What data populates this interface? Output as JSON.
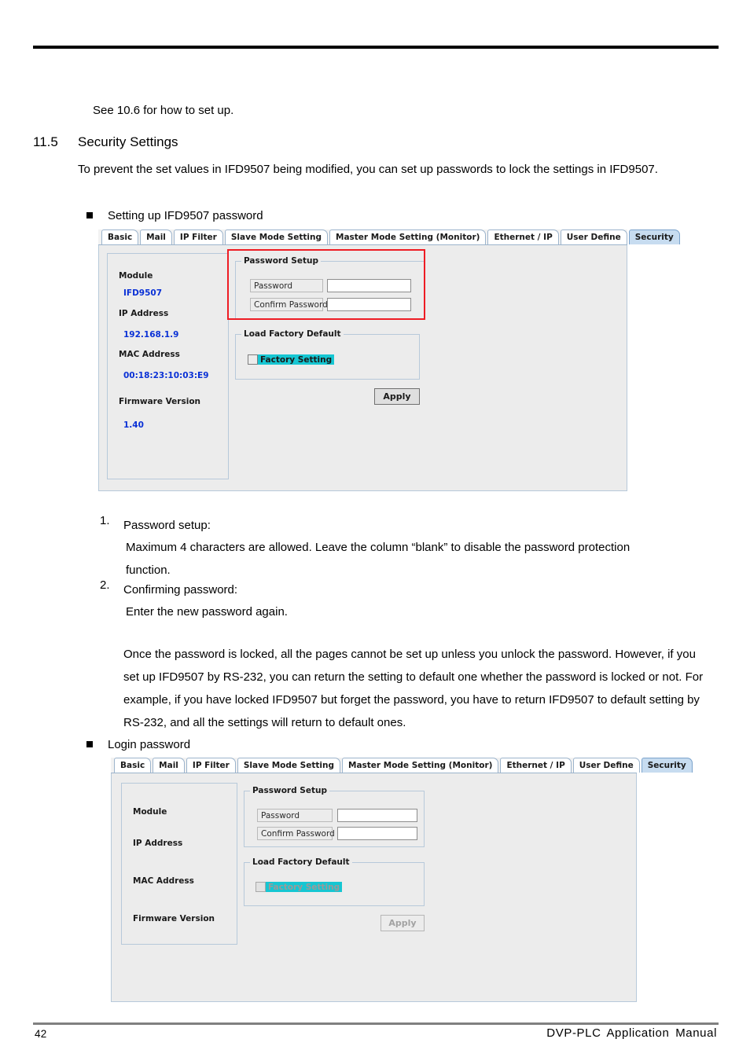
{
  "document": {
    "footer": {
      "page_number": "42",
      "manual_title": "DVP-PLC  Application  Manual"
    }
  },
  "content": {
    "intro_line": "See 10.6 for how to set up.",
    "section": {
      "number": "11.5",
      "title": "Security Settings",
      "paragraph": "To prevent the set values in IFD9507 being modified, you can set up passwords to lock the settings in IFD9507."
    },
    "bullet_1": "Setting up IFD9507 password",
    "bullet_2": "Login password",
    "list": [
      {
        "num": "1.",
        "title": "Password setup:",
        "body": "Maximum 4 characters are allowed. Leave the column “blank” to disable the password protection function."
      },
      {
        "num": "2.",
        "title": "Confirming password:",
        "body": "Enter the new password again."
      }
    ],
    "note_paragraph": "Once the password is locked, all the pages cannot be set up unless you unlock the password. However, if you set up IFD9507 by RS-232, you can return the setting to default one whether the password is locked or not. For example, if you have locked IFD9507 but forget the password, you have to return IFD9507 to default setting by RS-232, and all the settings will return to default ones."
  },
  "screenshot_1": {
    "tabs": [
      {
        "label": "Basic",
        "active": false
      },
      {
        "label": "Mail",
        "active": false
      },
      {
        "label": "IP Filter",
        "active": false
      },
      {
        "label": "Slave Mode Setting",
        "active": false
      },
      {
        "label": "Master Mode Setting (Monitor)",
        "active": false
      },
      {
        "label": "Ethernet / IP",
        "active": false
      },
      {
        "label": "User Define",
        "active": false
      },
      {
        "label": "Security",
        "active": true
      }
    ],
    "module_panel": {
      "module_label": "Module",
      "module_value": "IFD9507",
      "ip_label": "IP Address",
      "ip_value": "192.168.1.9",
      "mac_label": "MAC Address",
      "mac_value": "00:18:23:10:03:E9",
      "firmware_label": "Firmware Version",
      "firmware_value": "1.40"
    },
    "password_group": {
      "title": "Password Setup",
      "password_label": "Password",
      "password_value": "",
      "confirm_label": "Confirm Password",
      "confirm_value": ""
    },
    "factory_group": {
      "title": "Load Factory Default",
      "checkbox_label": "Factory Setting",
      "checked": false
    },
    "apply_button": "Apply"
  },
  "screenshot_2": {
    "tabs": [
      {
        "label": "Basic",
        "active": false
      },
      {
        "label": "Mail",
        "active": false
      },
      {
        "label": "IP Filter",
        "active": false
      },
      {
        "label": "Slave Mode Setting",
        "active": false
      },
      {
        "label": "Master Mode Setting (Monitor)",
        "active": false
      },
      {
        "label": "Ethernet / IP",
        "active": false
      },
      {
        "label": "User Define",
        "active": false
      },
      {
        "label": "Security",
        "active": true
      }
    ],
    "module_panel": {
      "module_label": "Module",
      "module_value": "",
      "ip_label": "IP Address",
      "ip_value": "",
      "mac_label": "MAC Address",
      "mac_value": "",
      "firmware_label": "Firmware Version",
      "firmware_value": ""
    },
    "password_group": {
      "title": "Password Setup",
      "password_label": "Password",
      "password_value": "",
      "confirm_label": "Confirm Password",
      "confirm_value": ""
    },
    "factory_group": {
      "title": "Load Factory Default",
      "checkbox_label": "Factory Setting",
      "checked": false
    },
    "apply_button": "Apply"
  },
  "colors": {
    "highlight_red": "#ee1c24",
    "value_blue": "#0a31d6",
    "checkbox_highlight": "#16c6d2",
    "active_tab": "#c7dcf0"
  }
}
